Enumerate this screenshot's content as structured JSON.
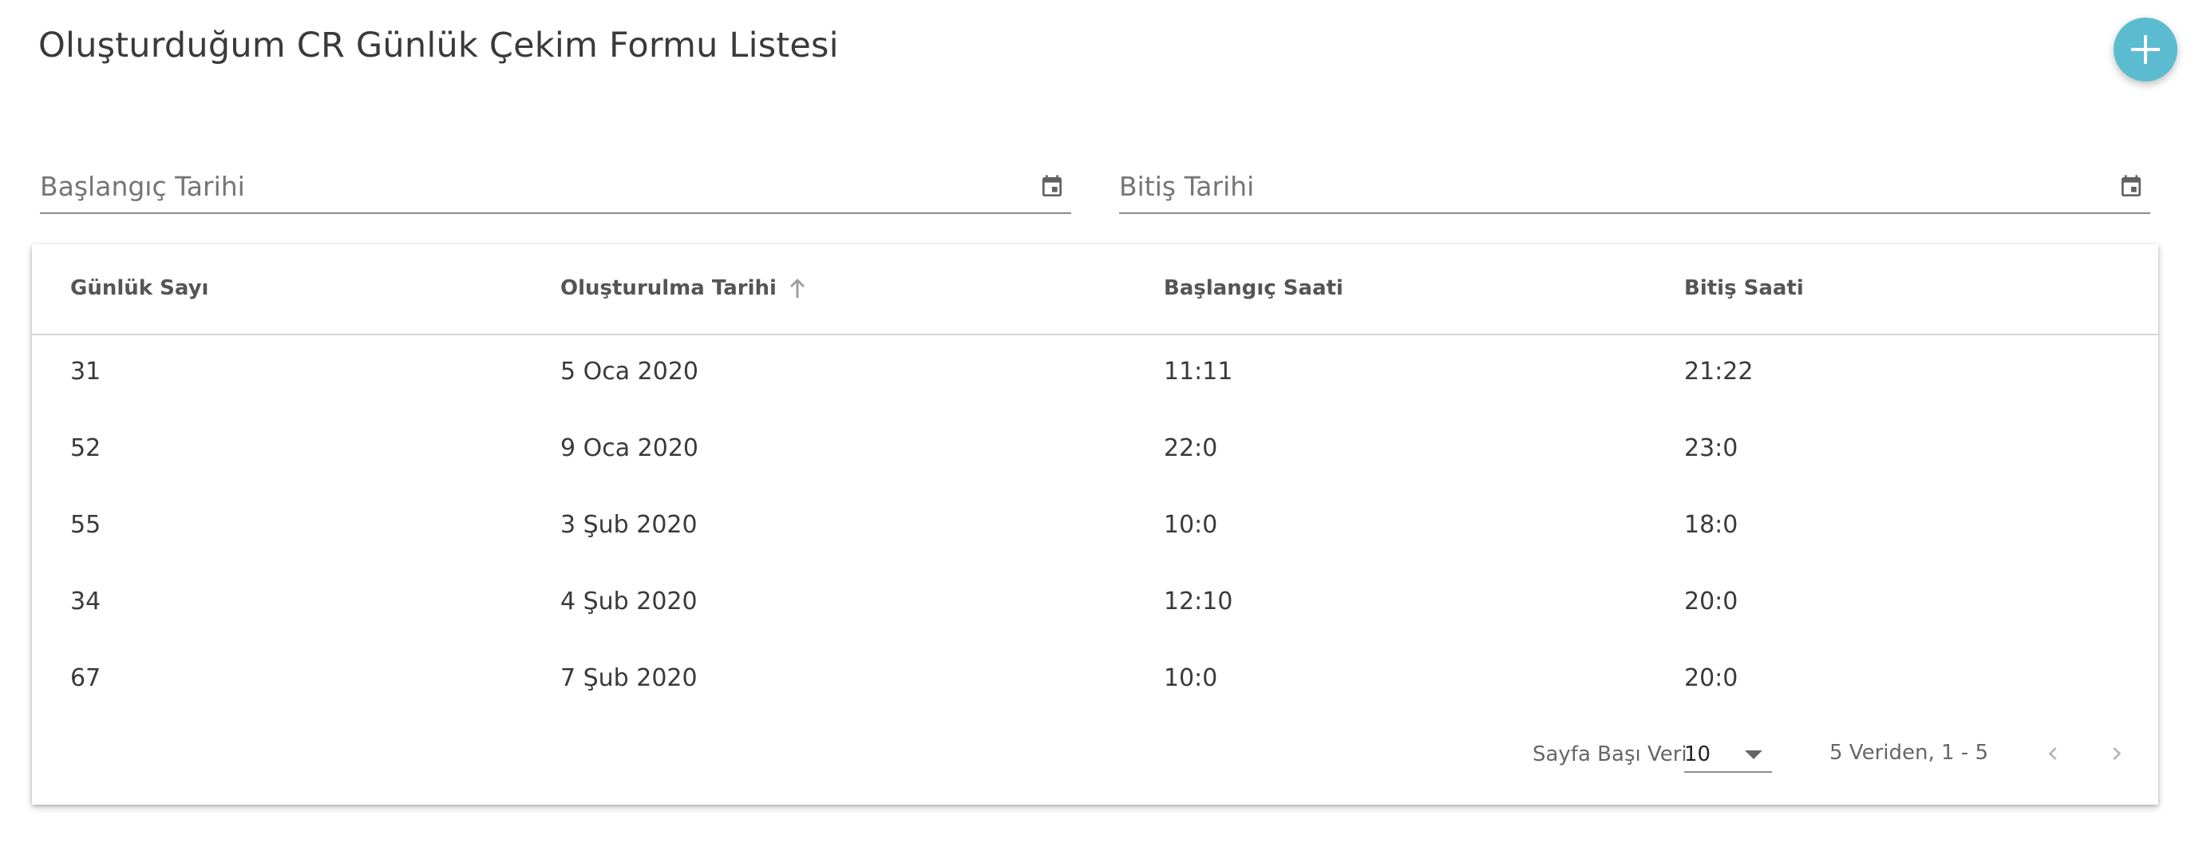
{
  "page": {
    "title": "Oluşturduğum CR Günlük Çekim Formu Listesi"
  },
  "add_button": {
    "icon": "plus-icon",
    "color": "#5bbcd1"
  },
  "filters": {
    "start_date_label": "Başlangıç Tarihi",
    "end_date_label": "Bitiş Tarihi",
    "icon": "calendar-icon"
  },
  "table": {
    "columns": [
      {
        "label": "Günlük Sayı"
      },
      {
        "label": "Oluşturulma Tarihi",
        "sorted": "ascending",
        "sort_icon": "arrow-up-icon"
      },
      {
        "label": "Başlangıç Saati"
      },
      {
        "label": "Bitiş Saati"
      }
    ],
    "rows": [
      [
        "31",
        "5 Oca 2020",
        "11:11",
        "21:22"
      ],
      [
        "52",
        "9 Oca 2020",
        "22:0",
        "23:0"
      ],
      [
        "55",
        "3 Şub 2020",
        "10:0",
        "18:0"
      ],
      [
        "34",
        "4 Şub 2020",
        "12:10",
        "20:0"
      ],
      [
        "67",
        "7 Şub 2020",
        "10:0",
        "20:0"
      ]
    ]
  },
  "pagination": {
    "per_page_label": "Sayfa Başı Veri",
    "per_page_value": "10",
    "range_text": "5 Veriden, 1 - 5",
    "prev_icon": "chevron-left-icon",
    "next_icon": "chevron-right-icon"
  }
}
